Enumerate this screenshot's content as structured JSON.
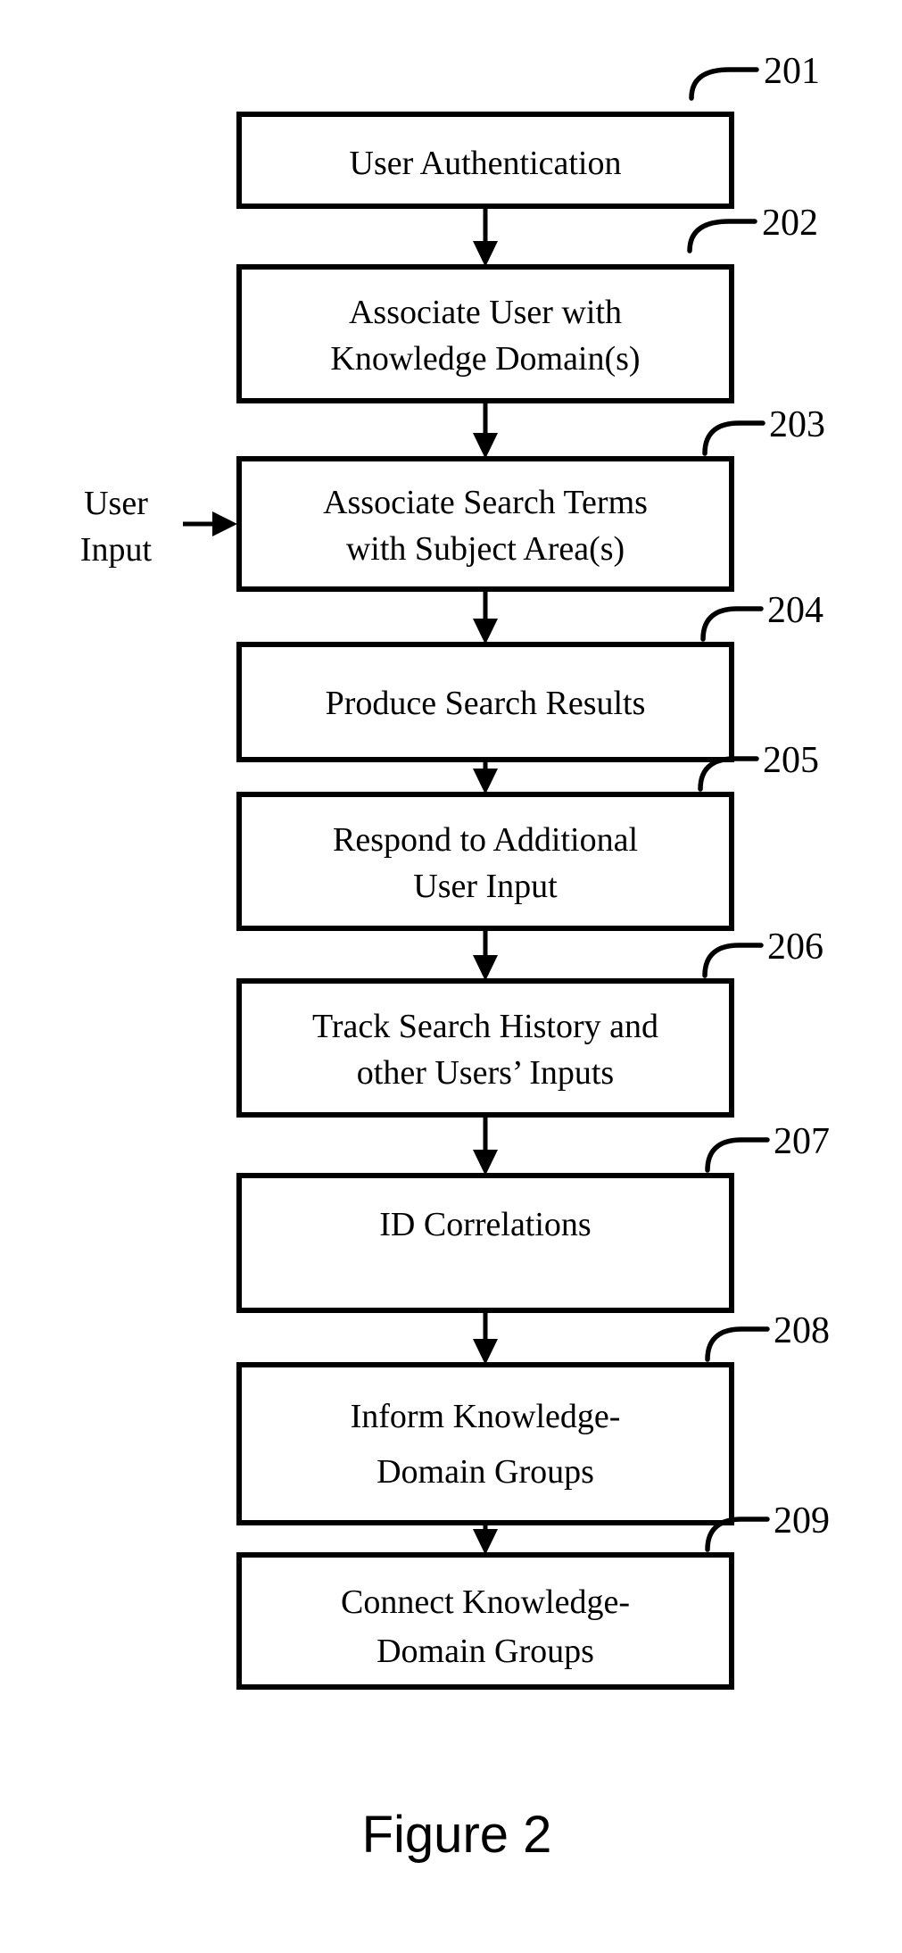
{
  "figure": {
    "caption": "Figure 2",
    "side_input_label_line1": "User",
    "side_input_label_line2": "Input"
  },
  "chart_data": {
    "type": "diagram",
    "title": "Figure 2",
    "diagram_kind": "flowchart",
    "orientation": "vertical",
    "nodes": [
      {
        "ref": "201",
        "lines": [
          "User Authentication"
        ]
      },
      {
        "ref": "202",
        "lines": [
          "Associate User with",
          "Knowledge Domain(s)"
        ]
      },
      {
        "ref": "203",
        "lines": [
          "Associate Search Terms",
          "with Subject Area(s)"
        ]
      },
      {
        "ref": "204",
        "lines": [
          "Produce Search Results"
        ]
      },
      {
        "ref": "205",
        "lines": [
          "Respond to Additional",
          "User Input"
        ]
      },
      {
        "ref": "206",
        "lines": [
          "Track Search History and",
          "other Users’ Inputs"
        ]
      },
      {
        "ref": "207",
        "lines": [
          "ID Correlations"
        ]
      },
      {
        "ref": "208",
        "lines": [
          "Inform Knowledge-",
          "Domain Groups"
        ]
      },
      {
        "ref": "209",
        "lines": [
          "Connect Knowledge-",
          "Domain Groups"
        ]
      }
    ],
    "edges": [
      {
        "from": "201",
        "to": "202"
      },
      {
        "from": "202",
        "to": "203"
      },
      {
        "from": "203",
        "to": "204"
      },
      {
        "from": "204",
        "to": "205"
      },
      {
        "from": "205",
        "to": "206"
      },
      {
        "from": "206",
        "to": "207"
      },
      {
        "from": "207",
        "to": "208"
      },
      {
        "from": "208",
        "to": "209"
      },
      {
        "from": "User Input",
        "to": "203",
        "direction": "right"
      }
    ],
    "external_inputs": [
      {
        "label": "User Input",
        "target_ref": "203"
      }
    ]
  },
  "boxes": {
    "b201": {
      "ref": "201",
      "line1": "User Authentication",
      "line2": ""
    },
    "b202": {
      "ref": "202",
      "line1": "Associate User with",
      "line2": "Knowledge Domain(s)"
    },
    "b203": {
      "ref": "203",
      "line1": "Associate Search Terms",
      "line2": "with Subject Area(s)"
    },
    "b204": {
      "ref": "204",
      "line1": "Produce Search Results",
      "line2": ""
    },
    "b205": {
      "ref": "205",
      "line1": "Respond to Additional",
      "line2": "User Input"
    },
    "b206": {
      "ref": "206",
      "line1": "Track Search History and",
      "line2": "other Users’ Inputs"
    },
    "b207": {
      "ref": "207",
      "line1": "ID Correlations",
      "line2": ""
    },
    "b208": {
      "ref": "208",
      "line1": "Inform Knowledge-",
      "line2": "Domain Groups"
    },
    "b209": {
      "ref": "209",
      "line1": "Connect Knowledge-",
      "line2": "Domain Groups"
    }
  },
  "colors": {
    "ink": "#000000",
    "paper": "#ffffff"
  }
}
